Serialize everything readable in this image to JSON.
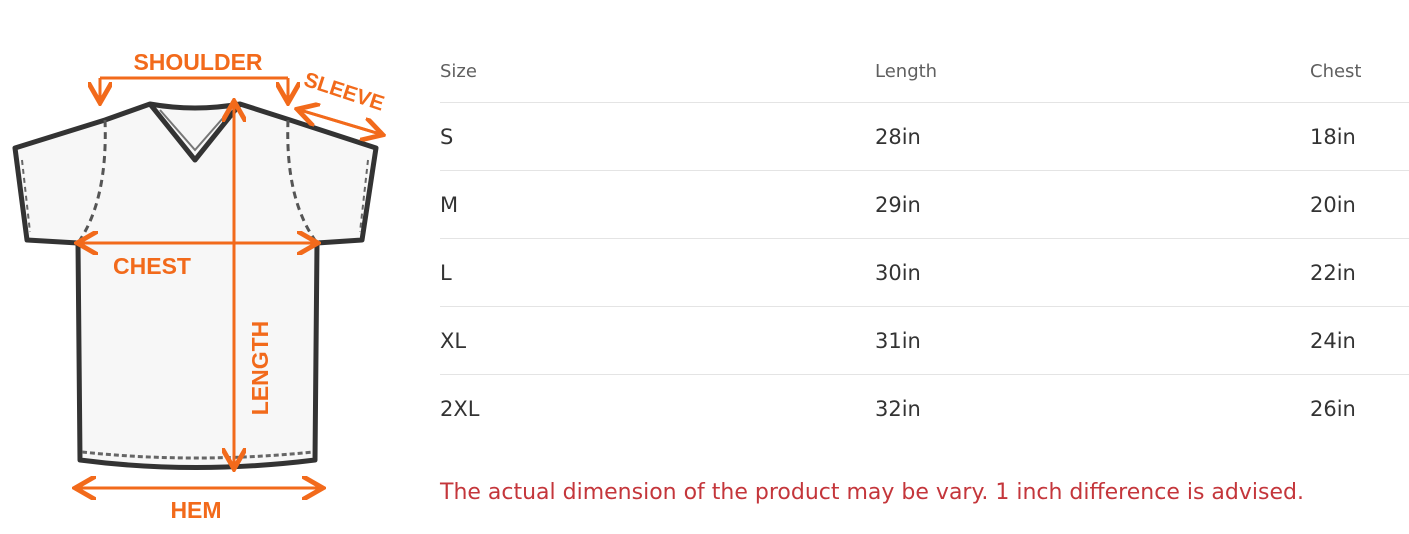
{
  "diagram": {
    "labels": {
      "shoulder": "SHOULDER",
      "sleeve": "SLEEVE",
      "chest": "CHEST",
      "length": "LENGTH",
      "hem": "HEM"
    },
    "accent_color": "#f26a1b",
    "outline_color": "#333333"
  },
  "table": {
    "headers": [
      "Size",
      "Length",
      "Chest"
    ],
    "rows": [
      [
        "S",
        "28in",
        "18in"
      ],
      [
        "M",
        "29in",
        "20in"
      ],
      [
        "L",
        "30in",
        "22in"
      ],
      [
        "XL",
        "31in",
        "24in"
      ],
      [
        "2XL",
        "32in",
        "26in"
      ]
    ]
  },
  "note": {
    "text": "The actual dimension of the product may be vary. 1 inch difference is advised.",
    "color": "#c4363b"
  }
}
